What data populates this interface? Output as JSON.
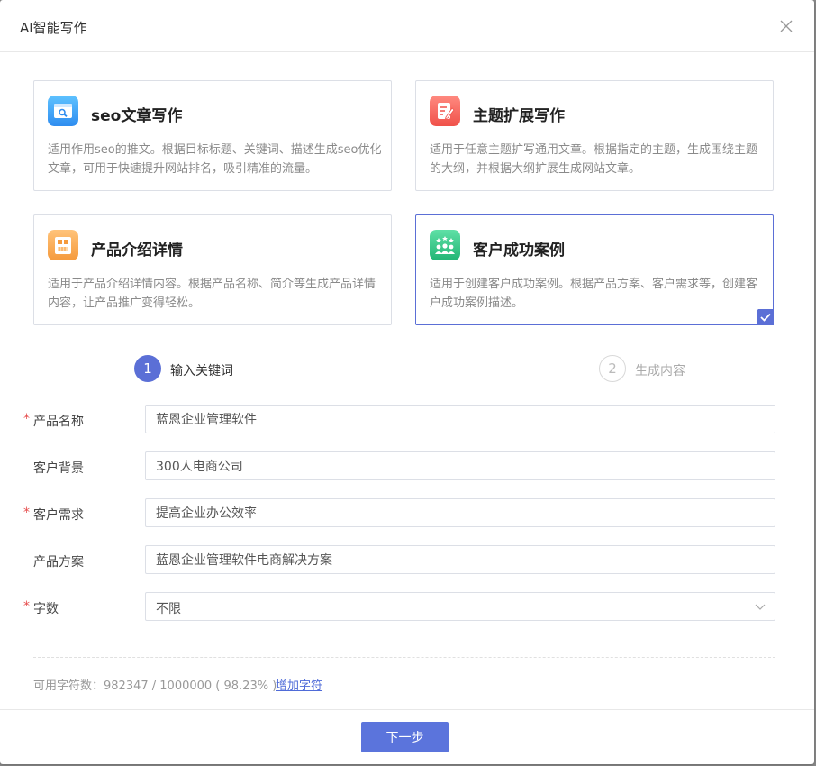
{
  "dialog": {
    "title": "AI智能写作"
  },
  "cards": [
    {
      "title": "seo文章写作",
      "desc": "适用作用seo的推文。根据目标标题、关键词、描述生成seo优化文章，可用于快速提升网站排名，吸引精准的流量。",
      "selected": false,
      "icon": "seo-browser-icon"
    },
    {
      "title": "主题扩展写作",
      "desc": "适用于任意主题扩写通用文章。根据指定的主题，生成围绕主题的大纲，并根据大纲扩展生成网站文章。",
      "selected": false,
      "icon": "document-pen-icon"
    },
    {
      "title": "产品介绍详情",
      "desc": "适用于产品介绍详情内容。根据产品名称、简介等生成产品详情内容，让产品推广变得轻松。",
      "selected": false,
      "icon": "product-store-icon"
    },
    {
      "title": "客户成功案例",
      "desc": "适用于创建客户成功案例。根据产品方案、客户需求等，创建客户成功案例描述。",
      "selected": true,
      "icon": "customer-group-icon"
    }
  ],
  "steps": [
    {
      "num": "1",
      "label": "输入关键词"
    },
    {
      "num": "2",
      "label": "生成内容"
    }
  ],
  "form": {
    "product_name": {
      "label": "产品名称",
      "value": "蓝恩企业管理软件"
    },
    "customer_background": {
      "label": "客户背景",
      "value": "300人电商公司"
    },
    "customer_needs": {
      "label": "客户需求",
      "value": "提高企业办公效率"
    },
    "product_solution": {
      "label": "产品方案",
      "value": "蓝恩企业管理软件电商解决方案"
    },
    "word_count": {
      "label": "字数",
      "value": "不限"
    },
    "required_mark": "*"
  },
  "quota": {
    "text": "可用字符数：982347 / 1000000 ( 98.23% )",
    "link": "增加字符"
  },
  "footer": {
    "next_label": "下一步"
  },
  "colors": {
    "accent": "#5b6fd6",
    "required": "#e64c4c"
  }
}
